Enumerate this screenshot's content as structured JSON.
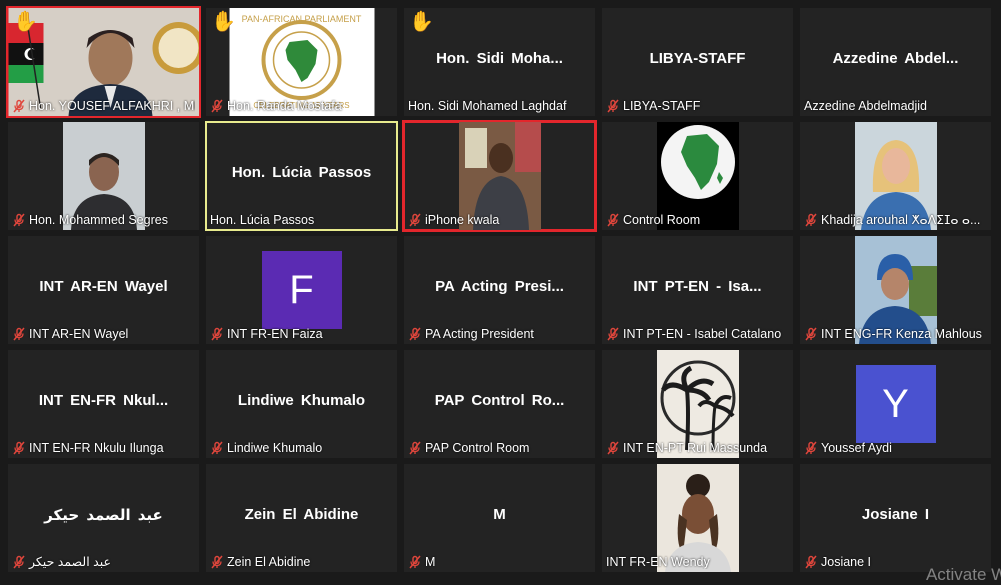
{
  "colors": {
    "tile_bg": "#232323",
    "active_speaker_border": "#e3262c",
    "spotlight_border": "#e8eb8e",
    "mute_icon": "#e0463c",
    "raised_hand": "#f3c020",
    "avatar_purple": "#5b2bb3",
    "avatar_blue": "#4a52d0"
  },
  "participants": [
    {
      "name": "Hon. YOUSEF ALFAKHRI , MP",
      "center": "",
      "muted": true,
      "hand": true,
      "video": "flag-person",
      "border": "red"
    },
    {
      "name": "Hon. Randa Mostafa",
      "center": "",
      "muted": true,
      "hand": true,
      "video": "pap-logo",
      "border": ""
    },
    {
      "name": "Hon. Sidi Mohamed Laghdaf",
      "center": "Hon. Sidi Moha...",
      "muted": false,
      "hand": true,
      "video": "",
      "border": ""
    },
    {
      "name": "LIBYA-STAFF",
      "center": "LIBYA-STAFF",
      "muted": true,
      "hand": false,
      "video": "",
      "border": ""
    },
    {
      "name": "Azzedine Abdelmadjid",
      "center": "Azzedine Abdel...",
      "muted": false,
      "hand": false,
      "video": "",
      "border": ""
    },
    {
      "name": "Hon. Mohammed Segres",
      "center": "",
      "muted": true,
      "hand": false,
      "video": "person",
      "border": ""
    },
    {
      "name": "Hon. Lúcia Passos",
      "center": "Hon. Lúcia Passos",
      "muted": false,
      "hand": false,
      "video": "",
      "border": "yellow"
    },
    {
      "name": "iPhone kwala",
      "center": "",
      "muted": true,
      "hand": false,
      "video": "room-person",
      "border": "red"
    },
    {
      "name": "Control Room",
      "center": "",
      "muted": true,
      "hand": false,
      "video": "globe",
      "border": ""
    },
    {
      "name": "Khadija arouhal ⵅⴰⴷⵉⵊⴰ ⴰ...",
      "center": "",
      "muted": true,
      "hand": false,
      "video": "woman",
      "border": ""
    },
    {
      "name": "INT AR-EN Wayel",
      "center": "INT AR-EN Wayel",
      "muted": true,
      "hand": false,
      "video": "",
      "border": ""
    },
    {
      "name": "INT FR-EN Faiza",
      "center": "",
      "muted": true,
      "hand": false,
      "video": "avatar-F",
      "border": ""
    },
    {
      "name": "PA Acting President",
      "center": "PA Acting Presi...",
      "muted": true,
      "hand": false,
      "video": "",
      "border": ""
    },
    {
      "name": "INT PT-EN - Isabel Catalano",
      "center": "INT PT-EN - Isa...",
      "muted": true,
      "hand": false,
      "video": "",
      "border": ""
    },
    {
      "name": "INT ENG-FR Kenza Mahlous",
      "center": "",
      "muted": true,
      "hand": false,
      "video": "woman2",
      "border": ""
    },
    {
      "name": "INT EN-FR Nkulu Ilunga",
      "center": "INT EN-FR Nkul...",
      "muted": true,
      "hand": false,
      "video": "",
      "border": ""
    },
    {
      "name": "Lindiwe Khumalo",
      "center": "Lindiwe Khumalo",
      "muted": true,
      "hand": false,
      "video": "",
      "border": ""
    },
    {
      "name": "PAP Control Room",
      "center": "PAP Control Ro...",
      "muted": true,
      "hand": false,
      "video": "",
      "border": ""
    },
    {
      "name": "INT EN-PT Rui Massunda",
      "center": "",
      "muted": true,
      "hand": false,
      "video": "palms",
      "border": ""
    },
    {
      "name": "Youssef Aydi",
      "center": "",
      "muted": true,
      "hand": false,
      "video": "avatar-Y",
      "border": ""
    },
    {
      "name": "عبد الصمد حيكر",
      "center": "عبد الصمد حيكر",
      "muted": true,
      "hand": false,
      "video": "",
      "border": ""
    },
    {
      "name": "Zein El Abidine",
      "center": "Zein El Abidine",
      "muted": true,
      "hand": false,
      "video": "",
      "border": ""
    },
    {
      "name": "M",
      "center": "M",
      "muted": true,
      "hand": false,
      "video": "",
      "border": ""
    },
    {
      "name": "INT FR-EN Wendy",
      "center": "",
      "muted": false,
      "hand": false,
      "video": "woman3",
      "border": ""
    },
    {
      "name": "Josiane I",
      "center": "Josiane I",
      "muted": true,
      "hand": false,
      "video": "",
      "border": ""
    }
  ],
  "avatars": {
    "F": "F",
    "Y": "Y"
  },
  "watermark": "Activate Wi"
}
